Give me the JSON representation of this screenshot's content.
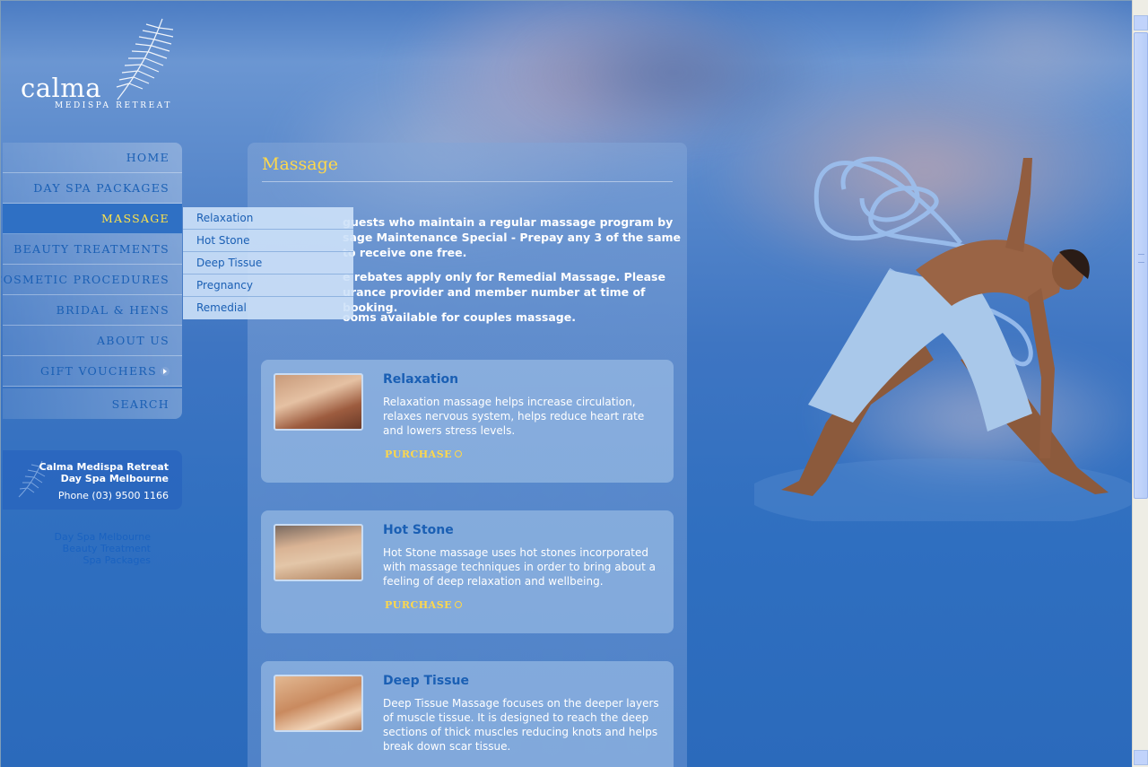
{
  "logo": {
    "name": "calma",
    "tagline": "MEDISPA RETREAT"
  },
  "nav": {
    "items": [
      {
        "label": "HOME"
      },
      {
        "label": "DAY SPA PACKAGES"
      },
      {
        "label": "MASSAGE",
        "active": true
      },
      {
        "label": "BEAUTY TREATMENTS"
      },
      {
        "label": "COSMETIC PROCEDURES"
      },
      {
        "label": "BRIDAL & HENS"
      },
      {
        "label": "ABOUT US"
      },
      {
        "label": "GIFT VOUCHERS"
      },
      {
        "label": "SEARCH"
      }
    ],
    "active_color": "#ffe34a"
  },
  "dropdown": {
    "items": [
      "Relaxation",
      "Hot Stone",
      "Deep Tissue",
      "Pregnancy",
      "Remedial"
    ]
  },
  "contact": {
    "line1": "Calma Medispa Retreat",
    "line2": "Day Spa Melbourne",
    "phone": "Phone (03) 9500 1166"
  },
  "footer_links": [
    "Day Spa Melbourne",
    "Beauty Treatment",
    "Spa Packages"
  ],
  "main": {
    "title": "Massage",
    "intro": [
      "guests who maintain a regular massage program by sage Maintenance Special - Prepay any 3 of the same to receive one free.",
      "e rebates apply only for Remedial Massage. Please urance provider and member number at time of booking.",
      "ooms available for couples massage."
    ],
    "cards": [
      {
        "title": "Relaxation",
        "desc": "Relaxation massage helps increase circulation, relaxes nervous system, helps reduce heart rate and lowers stress levels.",
        "cta": "PURCHASE"
      },
      {
        "title": "Hot Stone",
        "desc": "Hot Stone massage uses hot stones incorporated with massage techniques in order to bring about a feeling of deep relaxation and wellbeing.",
        "cta": "PURCHASE"
      },
      {
        "title": "Deep Tissue",
        "desc": "Deep Tissue Massage focuses on the deeper layers of muscle tissue. It is designed to reach the deep sections of thick muscles reducing knots and helps break down scar tissue.",
        "cta": ""
      }
    ]
  },
  "colors": {
    "title_yellow": "#ffd84a",
    "link_blue": "#1a5fb4"
  }
}
